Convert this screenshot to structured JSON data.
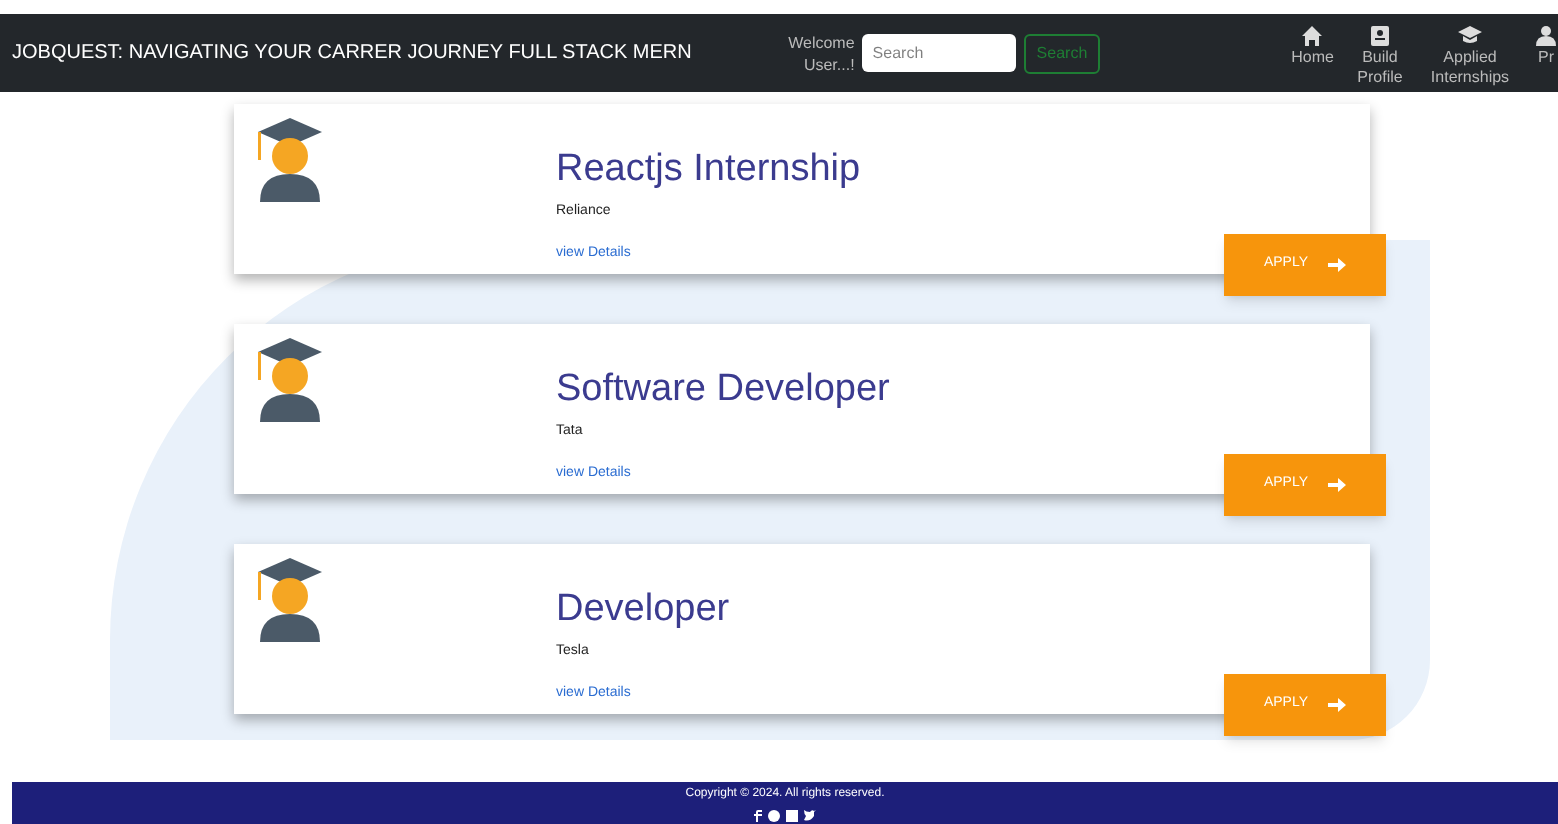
{
  "navbar": {
    "title": "JOBQUEST: NAVIGATING YOUR CARRER JOURNEY FULL STACK MERN",
    "welcome": "Welcome User...!",
    "search": {
      "placeholder": "Search"
    },
    "search_button": "Search",
    "nav_items": [
      {
        "label": "Home"
      },
      {
        "label": "Build Profile"
      },
      {
        "label": "Applied Internships"
      },
      {
        "label": "Pr"
      }
    ]
  },
  "jobs": [
    {
      "title": "Reactjs Internship",
      "company": "Reliance",
      "link": "view Details",
      "button": "APPLY"
    },
    {
      "title": "Software Developer",
      "company": "Tata",
      "link": "view Details",
      "button": "APPLY"
    },
    {
      "title": "Developer",
      "company": "Tesla",
      "link": "view Details",
      "button": "APPLY"
    }
  ],
  "footer": {
    "copyright": "Copyright © 2024. All rights reserved."
  }
}
